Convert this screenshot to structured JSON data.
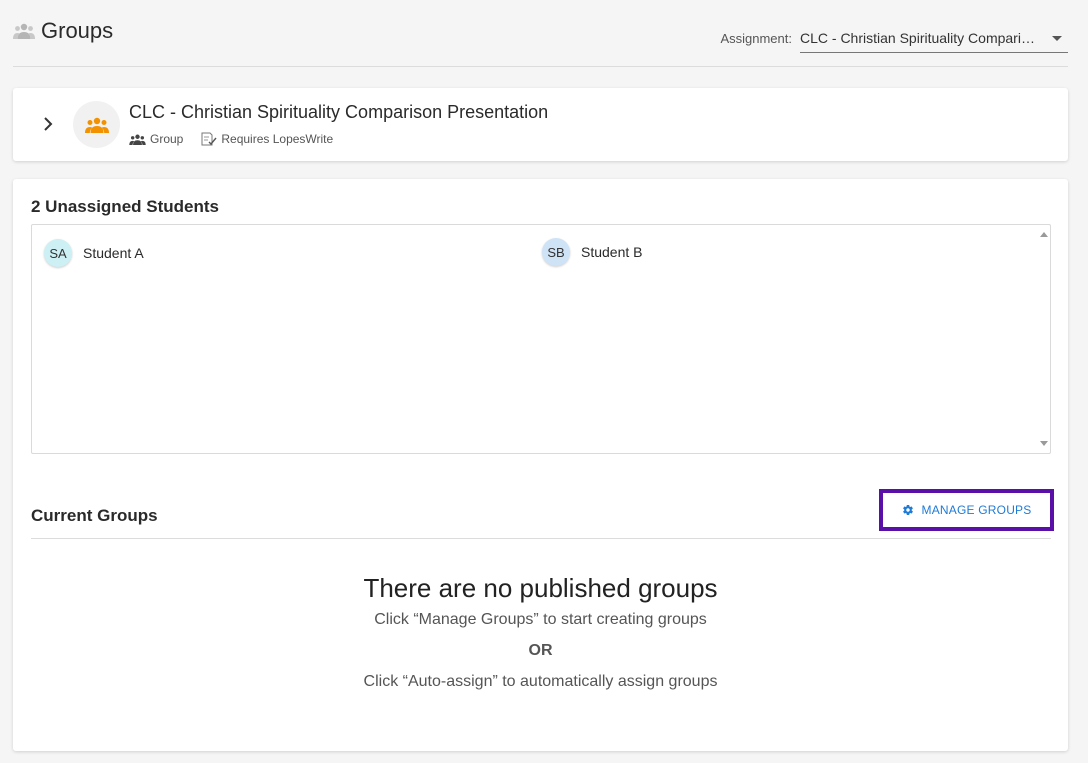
{
  "header": {
    "title": "Groups",
    "assignment_label": "Assignment:",
    "assignment_value": "CLC - Christian Spirituality Comparison Presentation"
  },
  "assignment_card": {
    "title": "CLC - Christian Spirituality Comparison Presentation",
    "type_label": "Group",
    "requirement_label": "Requires LopesWrite"
  },
  "unassigned": {
    "title": "2 Unassigned Students",
    "students": [
      {
        "initials": "SA",
        "name": "Student A",
        "color": "#cdf0f5"
      },
      {
        "initials": "SB",
        "name": "Student B",
        "color": "#cfe3f7"
      }
    ]
  },
  "current_groups": {
    "title": "Current Groups",
    "manage_label": "MANAGE GROUPS",
    "empty_title": "There are no published groups",
    "empty_line1": "Click “Manage Groups” to start creating groups",
    "empty_or": "OR",
    "empty_line2": "Click “Auto-assign” to automatically assign groups"
  },
  "colors": {
    "accent_blue": "#1e7bd6",
    "highlight_purple": "#5a0fa8",
    "group_icon_orange": "#f39200"
  },
  "icons": {
    "title": "people-icon",
    "expand": "chevron-right-icon",
    "group": "group-icon",
    "lopeswrite": "document-check-icon",
    "manage": "gear-icon",
    "dropdown": "caret-down-icon"
  }
}
